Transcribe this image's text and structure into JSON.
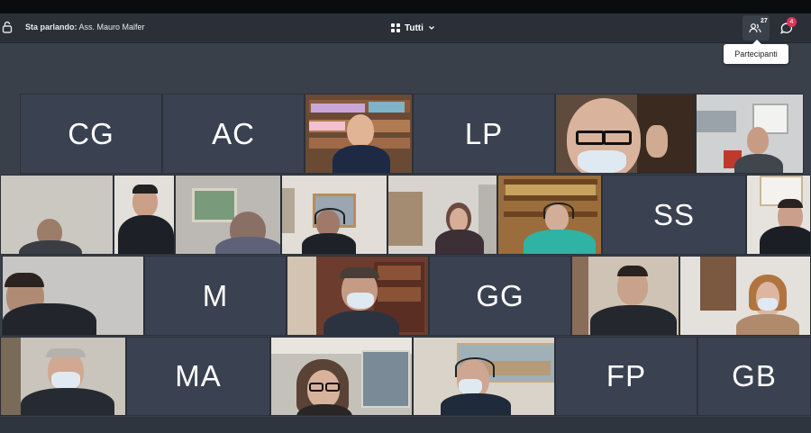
{
  "toolbar": {
    "speaking_label": "Sta parlando:",
    "speaking_name": "Ass. Mauro Malfer",
    "view_label": "Tutti",
    "participants_count": "27",
    "chat_badge": "4",
    "tooltip": "Partecipanti"
  },
  "tiles": {
    "cg": "CG",
    "ac": "AC",
    "lp": "LP",
    "ss": "SS",
    "m": "M",
    "gg": "GG",
    "ma": "MA",
    "fp": "FP",
    "gb": "GB"
  },
  "icons": {
    "lock": "lock-icon",
    "view": "grid-icon",
    "participants": "people-icon",
    "chat": "chat-icon"
  },
  "colors": {
    "background": "#3a4049",
    "toolbar": "#2b3038",
    "tile": "#3a4150",
    "badge": "#e0355a"
  }
}
